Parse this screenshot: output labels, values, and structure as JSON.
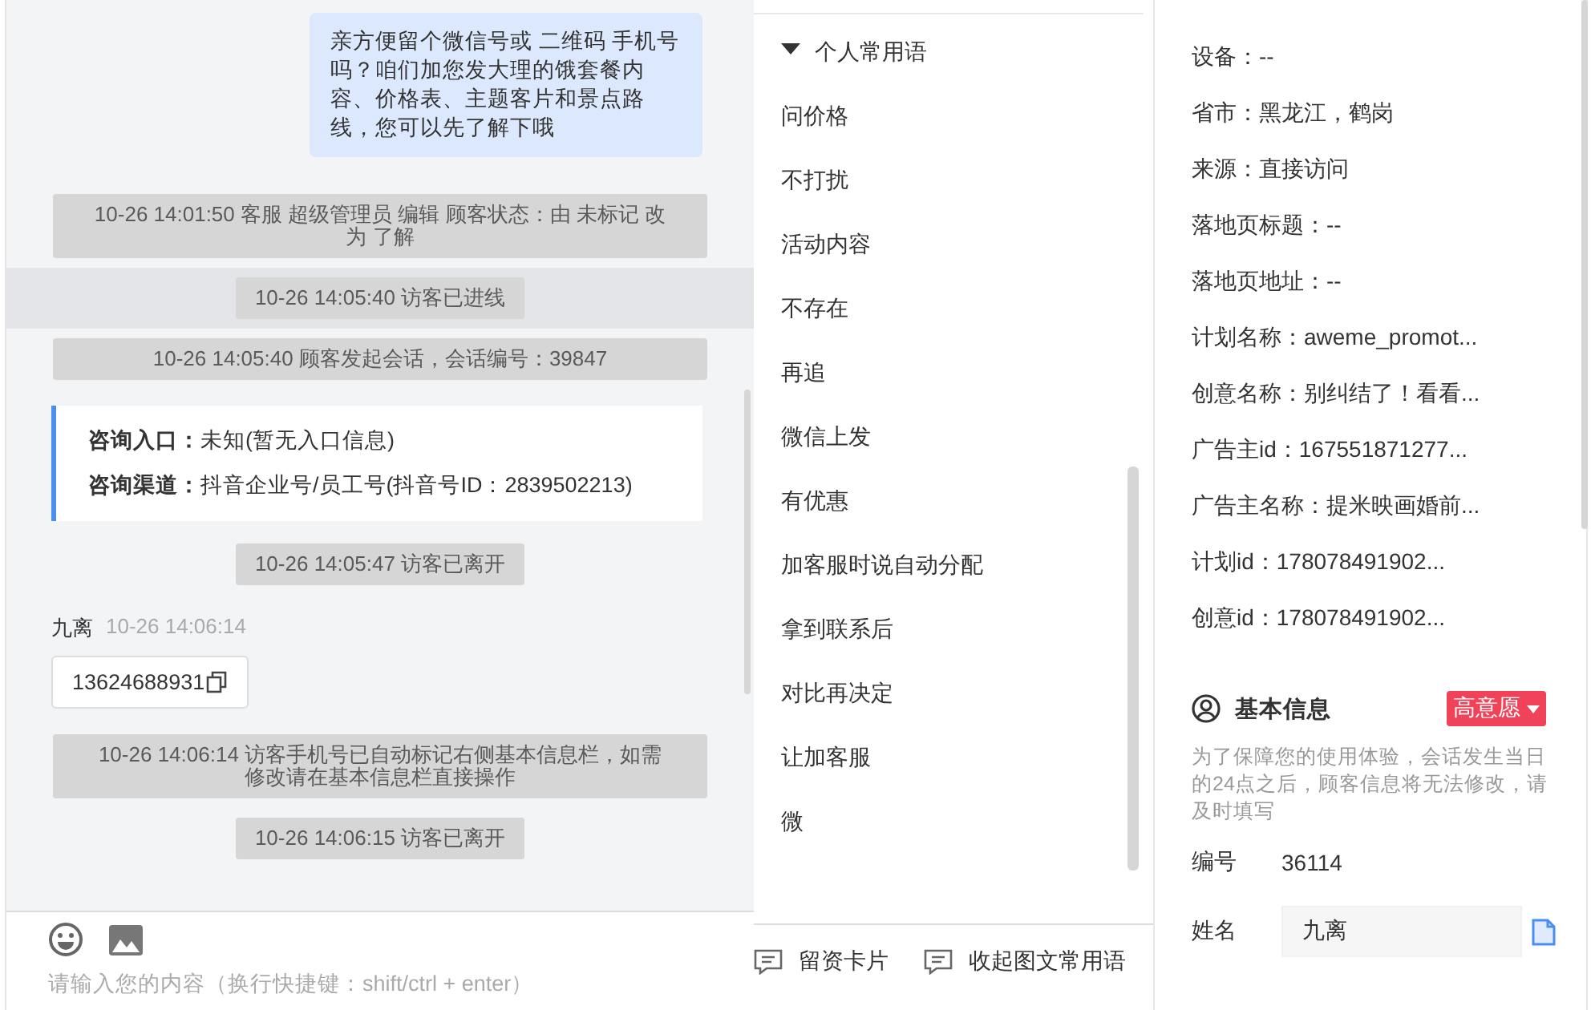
{
  "chat": {
    "messages": [
      {
        "kind": "bubble",
        "text": "亲方便留个微信号或 二维码 手机号吗？咱们加您发大理的饿套餐内容、价格表、主题客片和景点路线，您可以先了解下哦"
      },
      {
        "kind": "system",
        "text": "10-26 14:01:50 客服 超级管理员 编辑 顾客状态：由 未标记 改为 了解",
        "highlighted": false
      },
      {
        "kind": "system",
        "text": "10-26 14:05:40 访客已进线",
        "highlighted": true
      },
      {
        "kind": "system",
        "text": "10-26 14:05:40 顾客发起会话，会话编号：39847",
        "highlighted": false
      },
      {
        "kind": "info",
        "rows": [
          {
            "label": "咨询入口：",
            "value": "未知(暂无入口信息)"
          },
          {
            "label": "咨询渠道：",
            "value": "抖音企业号/员工号(抖音号ID：2839502213)"
          }
        ]
      },
      {
        "kind": "system",
        "text": "10-26 14:05:47 访客已离开",
        "highlighted": false
      },
      {
        "kind": "visitor",
        "name": "九离",
        "time": "10-26 14:06:14",
        "text": "13624688931"
      },
      {
        "kind": "system",
        "text": "10-26 14:06:14 访客手机号已自动标记右侧基本信息栏，如需修改请在基本信息栏直接操作",
        "highlighted": false
      },
      {
        "kind": "system",
        "text": "10-26 14:06:15 访客已离开",
        "highlighted": false
      }
    ]
  },
  "composer": {
    "placeholder": "请输入您的内容（换行快捷键：shift/ctrl + enter）"
  },
  "phrases": {
    "group": {
      "label": "个人常用语",
      "expanded": true
    },
    "items": [
      "问价格",
      "不打扰",
      "活动内容",
      "不存在",
      "再追",
      "微信上发",
      "有优惠",
      "加客服时说自动分配",
      "拿到联系后",
      "对比再决定",
      "让加客服",
      "微"
    ]
  },
  "actions": [
    "留资卡片",
    "收起图文常用语"
  ],
  "source_info": {
    "rows": [
      "设备：--",
      "省市：黑龙江，鹤岗",
      "来源：直接访问",
      "落地页标题：--",
      "落地页地址：--",
      "计划名称：aweme_promot...",
      "创意名称：别纠结了！看看...",
      "广告主id：167551871277...",
      "广告主名称：提米映画婚前...",
      "计划id：178078491902...",
      "创意id：178078491902..."
    ]
  },
  "basic_info": {
    "title": "基本信息",
    "tag": "高意愿",
    "notice": "为了保障您的使用体验，会话发生当日的24点之后，顾客信息将无法修改，请及时填写",
    "fields": [
      {
        "kind": "text",
        "label": "编号",
        "value": "36114"
      },
      {
        "kind": "input",
        "label": "姓名",
        "value": "九离"
      }
    ]
  }
}
